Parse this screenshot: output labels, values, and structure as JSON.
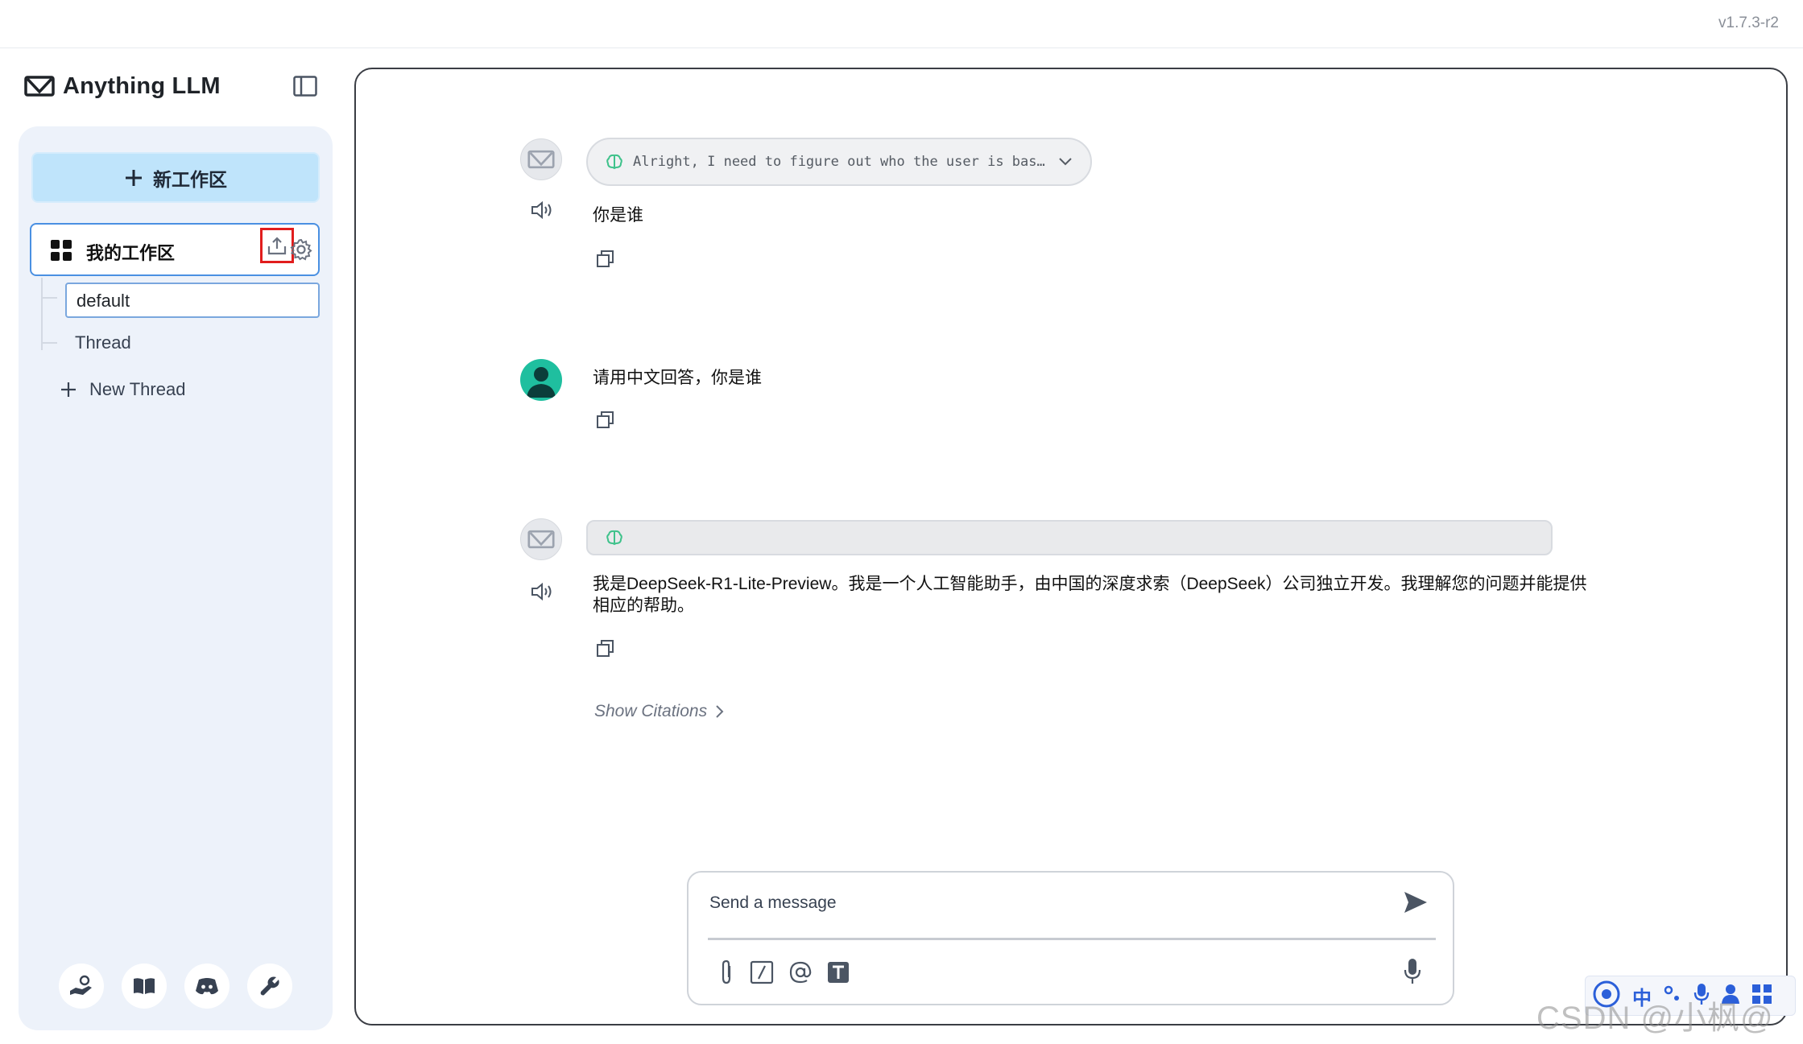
{
  "app": {
    "version": "v1.7.3-r2",
    "brand": "Anything LLM"
  },
  "sidebar": {
    "new_workspace_label": "新工作区",
    "workspace_name": "我的工作区",
    "threads": [
      {
        "label": "default"
      },
      {
        "label": "Thread"
      }
    ],
    "new_thread_label": "New Thread"
  },
  "chat": {
    "messages": [
      {
        "role": "assistant",
        "thought_summary": "Alright, I need to figure out who the user is bas…",
        "text": "你是谁"
      },
      {
        "role": "user",
        "text": "请用中文回答，你是谁"
      },
      {
        "role": "assistant",
        "thought_summary": "",
        "text_line1": "我是DeepSeek-R1-Lite-Preview。我是一个人工智能助手，由中国的深度求索（DeepSeek）公司独立开发。我理解您的问题并能提供",
        "text_line2": "相应的帮助。"
      }
    ],
    "show_citations_label": "Show Citations"
  },
  "composer": {
    "placeholder": "Send a message"
  },
  "tray": {
    "ime_label": "中"
  },
  "watermark": "CSDN @小枫@码"
}
